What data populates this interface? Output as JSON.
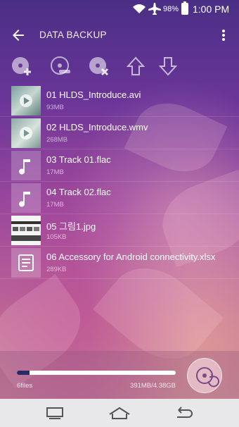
{
  "status_bar": {
    "battery": "98%",
    "time": "1:00 PM"
  },
  "action_bar": {
    "title": "DATA BACKUP"
  },
  "toolbar": {
    "icons": [
      "add-disc-icon",
      "disc-search-icon",
      "remove-disc-icon",
      "move-up-icon",
      "move-down-icon"
    ]
  },
  "files": [
    {
      "name": "01  HLDS_Introduce.avi",
      "size": "93MB",
      "type": "video"
    },
    {
      "name": "02  HLDS_Introduce.wmv",
      "size": "268MB",
      "type": "video"
    },
    {
      "name": "03  Track 01.flac",
      "size": "17MB",
      "type": "audio"
    },
    {
      "name": "04  Track 02.flac",
      "size": "17MB",
      "type": "audio"
    },
    {
      "name": "05  그림1.jpg",
      "size": "105KB",
      "type": "image"
    },
    {
      "name": "06  Accessory for Android connectivity.xlsx",
      "size": "289KB",
      "type": "document"
    }
  ],
  "summary": {
    "files_count": "6files",
    "size": "391MB/4.38GB",
    "progress_fraction": 0.08
  },
  "colors": {
    "accent": "#6a3598",
    "progress_fill": "#2a2a6a"
  }
}
